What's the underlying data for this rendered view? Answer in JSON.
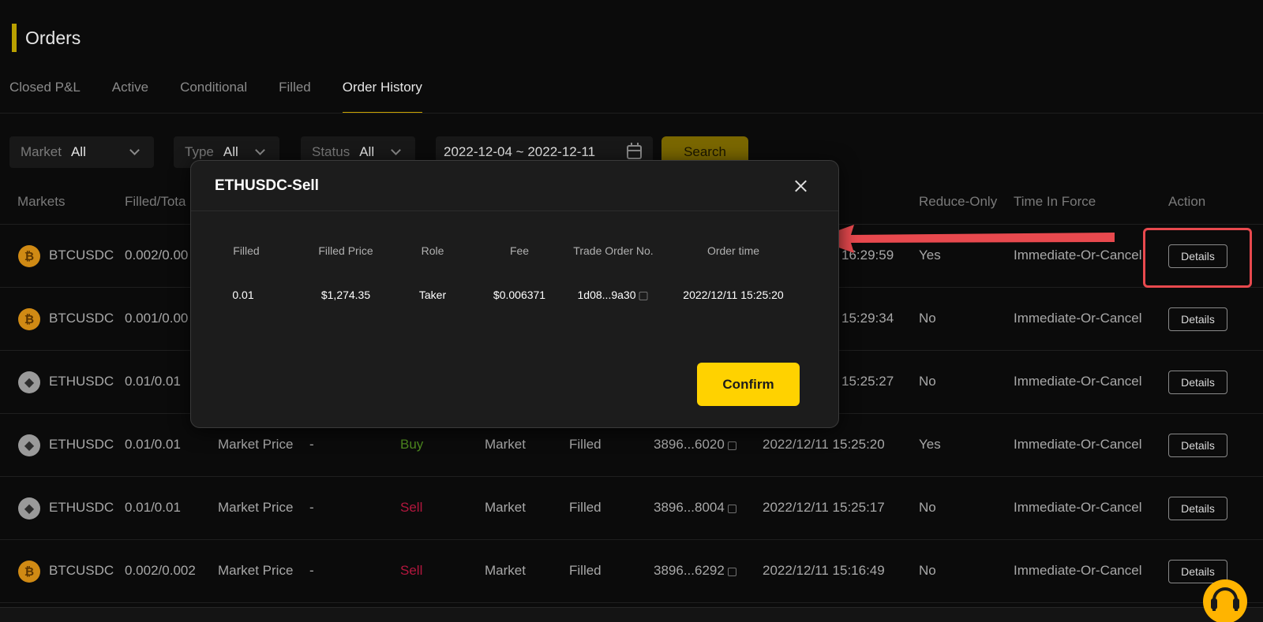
{
  "header": {
    "title": "Orders"
  },
  "tabs": [
    {
      "label": "Closed P&L",
      "active": false
    },
    {
      "label": "Active",
      "active": false
    },
    {
      "label": "Conditional",
      "active": false
    },
    {
      "label": "Filled",
      "active": false
    },
    {
      "label": "Order History",
      "active": true
    }
  ],
  "filters": {
    "market": {
      "label": "Market",
      "value": "All"
    },
    "type": {
      "label": "Type",
      "value": "All"
    },
    "status": {
      "label": "Status",
      "value": "All"
    },
    "date_range": "2022-12-04 ~ 2022-12-11",
    "search_label": "Search"
  },
  "table": {
    "headers": {
      "markets": "Markets",
      "filled_total": "Filled/Tota",
      "reduce_only": "Reduce-Only",
      "time_in_force": "Time In Force",
      "action": "Action"
    },
    "rows": [
      {
        "coin": "btc",
        "market": "BTCUSDC",
        "filled": "0.002/0.00",
        "price": "",
        "dash": "",
        "side": "",
        "side_class": "",
        "type": "",
        "status": "",
        "order_no": "",
        "time": "16:29:59",
        "reduce_only": "Yes",
        "tif": "Immediate-Or-Cancel",
        "action": "Details"
      },
      {
        "coin": "btc",
        "market": "BTCUSDC",
        "filled": "0.001/0.00",
        "price": "",
        "dash": "",
        "side": "",
        "side_class": "",
        "type": "",
        "status": "",
        "order_no": "",
        "time": "15:29:34",
        "reduce_only": "No",
        "tif": "Immediate-Or-Cancel",
        "action": "Details"
      },
      {
        "coin": "eth",
        "market": "ETHUSDC",
        "filled": "0.01/0.01",
        "price": "",
        "dash": "",
        "side": "",
        "side_class": "",
        "type": "",
        "status": "",
        "order_no": "",
        "time": "15:25:27",
        "reduce_only": "No",
        "tif": "Immediate-Or-Cancel",
        "action": "Details"
      },
      {
        "coin": "eth",
        "market": "ETHUSDC",
        "filled": "0.01/0.01",
        "price": "Market Price",
        "dash": "-",
        "side": "Buy",
        "side_class": "buy",
        "type": "Market",
        "status": "Filled",
        "order_no": "3896...6020",
        "time": "2022/12/11 15:25:20",
        "reduce_only": "Yes",
        "tif": "Immediate-Or-Cancel",
        "action": "Details"
      },
      {
        "coin": "eth",
        "market": "ETHUSDC",
        "filled": "0.01/0.01",
        "price": "Market Price",
        "dash": "-",
        "side": "Sell",
        "side_class": "sell",
        "type": "Market",
        "status": "Filled",
        "order_no": "3896...8004",
        "time": "2022/12/11 15:25:17",
        "reduce_only": "No",
        "tif": "Immediate-Or-Cancel",
        "action": "Details"
      },
      {
        "coin": "btc",
        "market": "BTCUSDC",
        "filled": "0.002/0.002",
        "price": "Market Price",
        "dash": "-",
        "side": "Sell",
        "side_class": "sell",
        "type": "Market",
        "status": "Filled",
        "order_no": "3896...6292",
        "time": "2022/12/11 15:16:49",
        "reduce_only": "No",
        "tif": "Immediate-Or-Cancel",
        "action": "Details"
      }
    ]
  },
  "modal": {
    "title": "ETHUSDC-Sell",
    "headers": [
      "Filled",
      "Filled Price",
      "Role",
      "Fee",
      "Trade Order No.",
      "Order time"
    ],
    "values": [
      "0.01",
      "$1,274.35",
      "Taker",
      "$0.006371",
      "1d08...9a30",
      "2022/12/11 15:25:20"
    ],
    "confirm_label": "Confirm"
  },
  "annotation": {
    "color": "#e8494e"
  }
}
